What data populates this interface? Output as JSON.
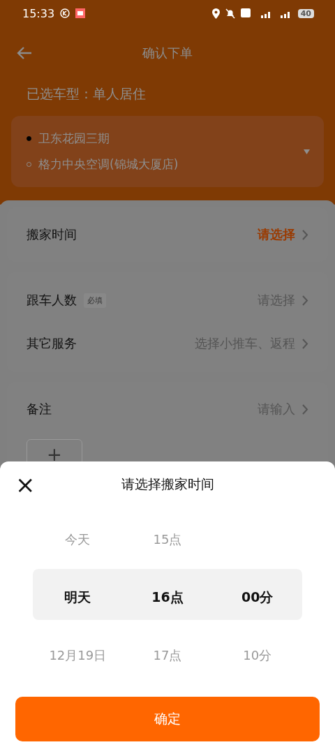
{
  "status_bar": {
    "time": "15:33",
    "battery": "40"
  },
  "header": {
    "title": "确认下单"
  },
  "vehicle": {
    "label": "已选车型：",
    "value": "单人居住"
  },
  "route": {
    "stops": [
      {
        "name": "卫东花园三期",
        "kind": "start"
      },
      {
        "name": "格力中央空调(锦城大厦店)",
        "kind": "end"
      }
    ]
  },
  "form_groups": [
    {
      "rows": [
        {
          "label": "搬家时间",
          "value": "请选择",
          "highlighted": true
        }
      ]
    },
    {
      "rows": [
        {
          "label": "跟车人数",
          "badge": "必填",
          "value": "请选择",
          "highlighted": false
        },
        {
          "label": "其它服务",
          "value": "选择小推车、返程",
          "highlighted": false
        }
      ]
    },
    {
      "rows": [
        {
          "label": "备注",
          "value": "请输入",
          "highlighted": false
        }
      ],
      "add_button": "+"
    }
  ],
  "sheet": {
    "close": "×",
    "title": "请选择搬家时间",
    "columns": [
      {
        "items": [
          {
            "label": "今天",
            "selected": false
          },
          {
            "label": "明天",
            "selected": true
          },
          {
            "label": "12月19日",
            "selected": false
          }
        ]
      },
      {
        "items": [
          {
            "label": "15点",
            "selected": false
          },
          {
            "label": "16点",
            "selected": true
          },
          {
            "label": "17点",
            "selected": false
          }
        ]
      },
      {
        "items": [
          {
            "label": "00分",
            "selected": true
          },
          {
            "label": "10分",
            "selected": false
          }
        ]
      }
    ],
    "confirm": "确定"
  }
}
